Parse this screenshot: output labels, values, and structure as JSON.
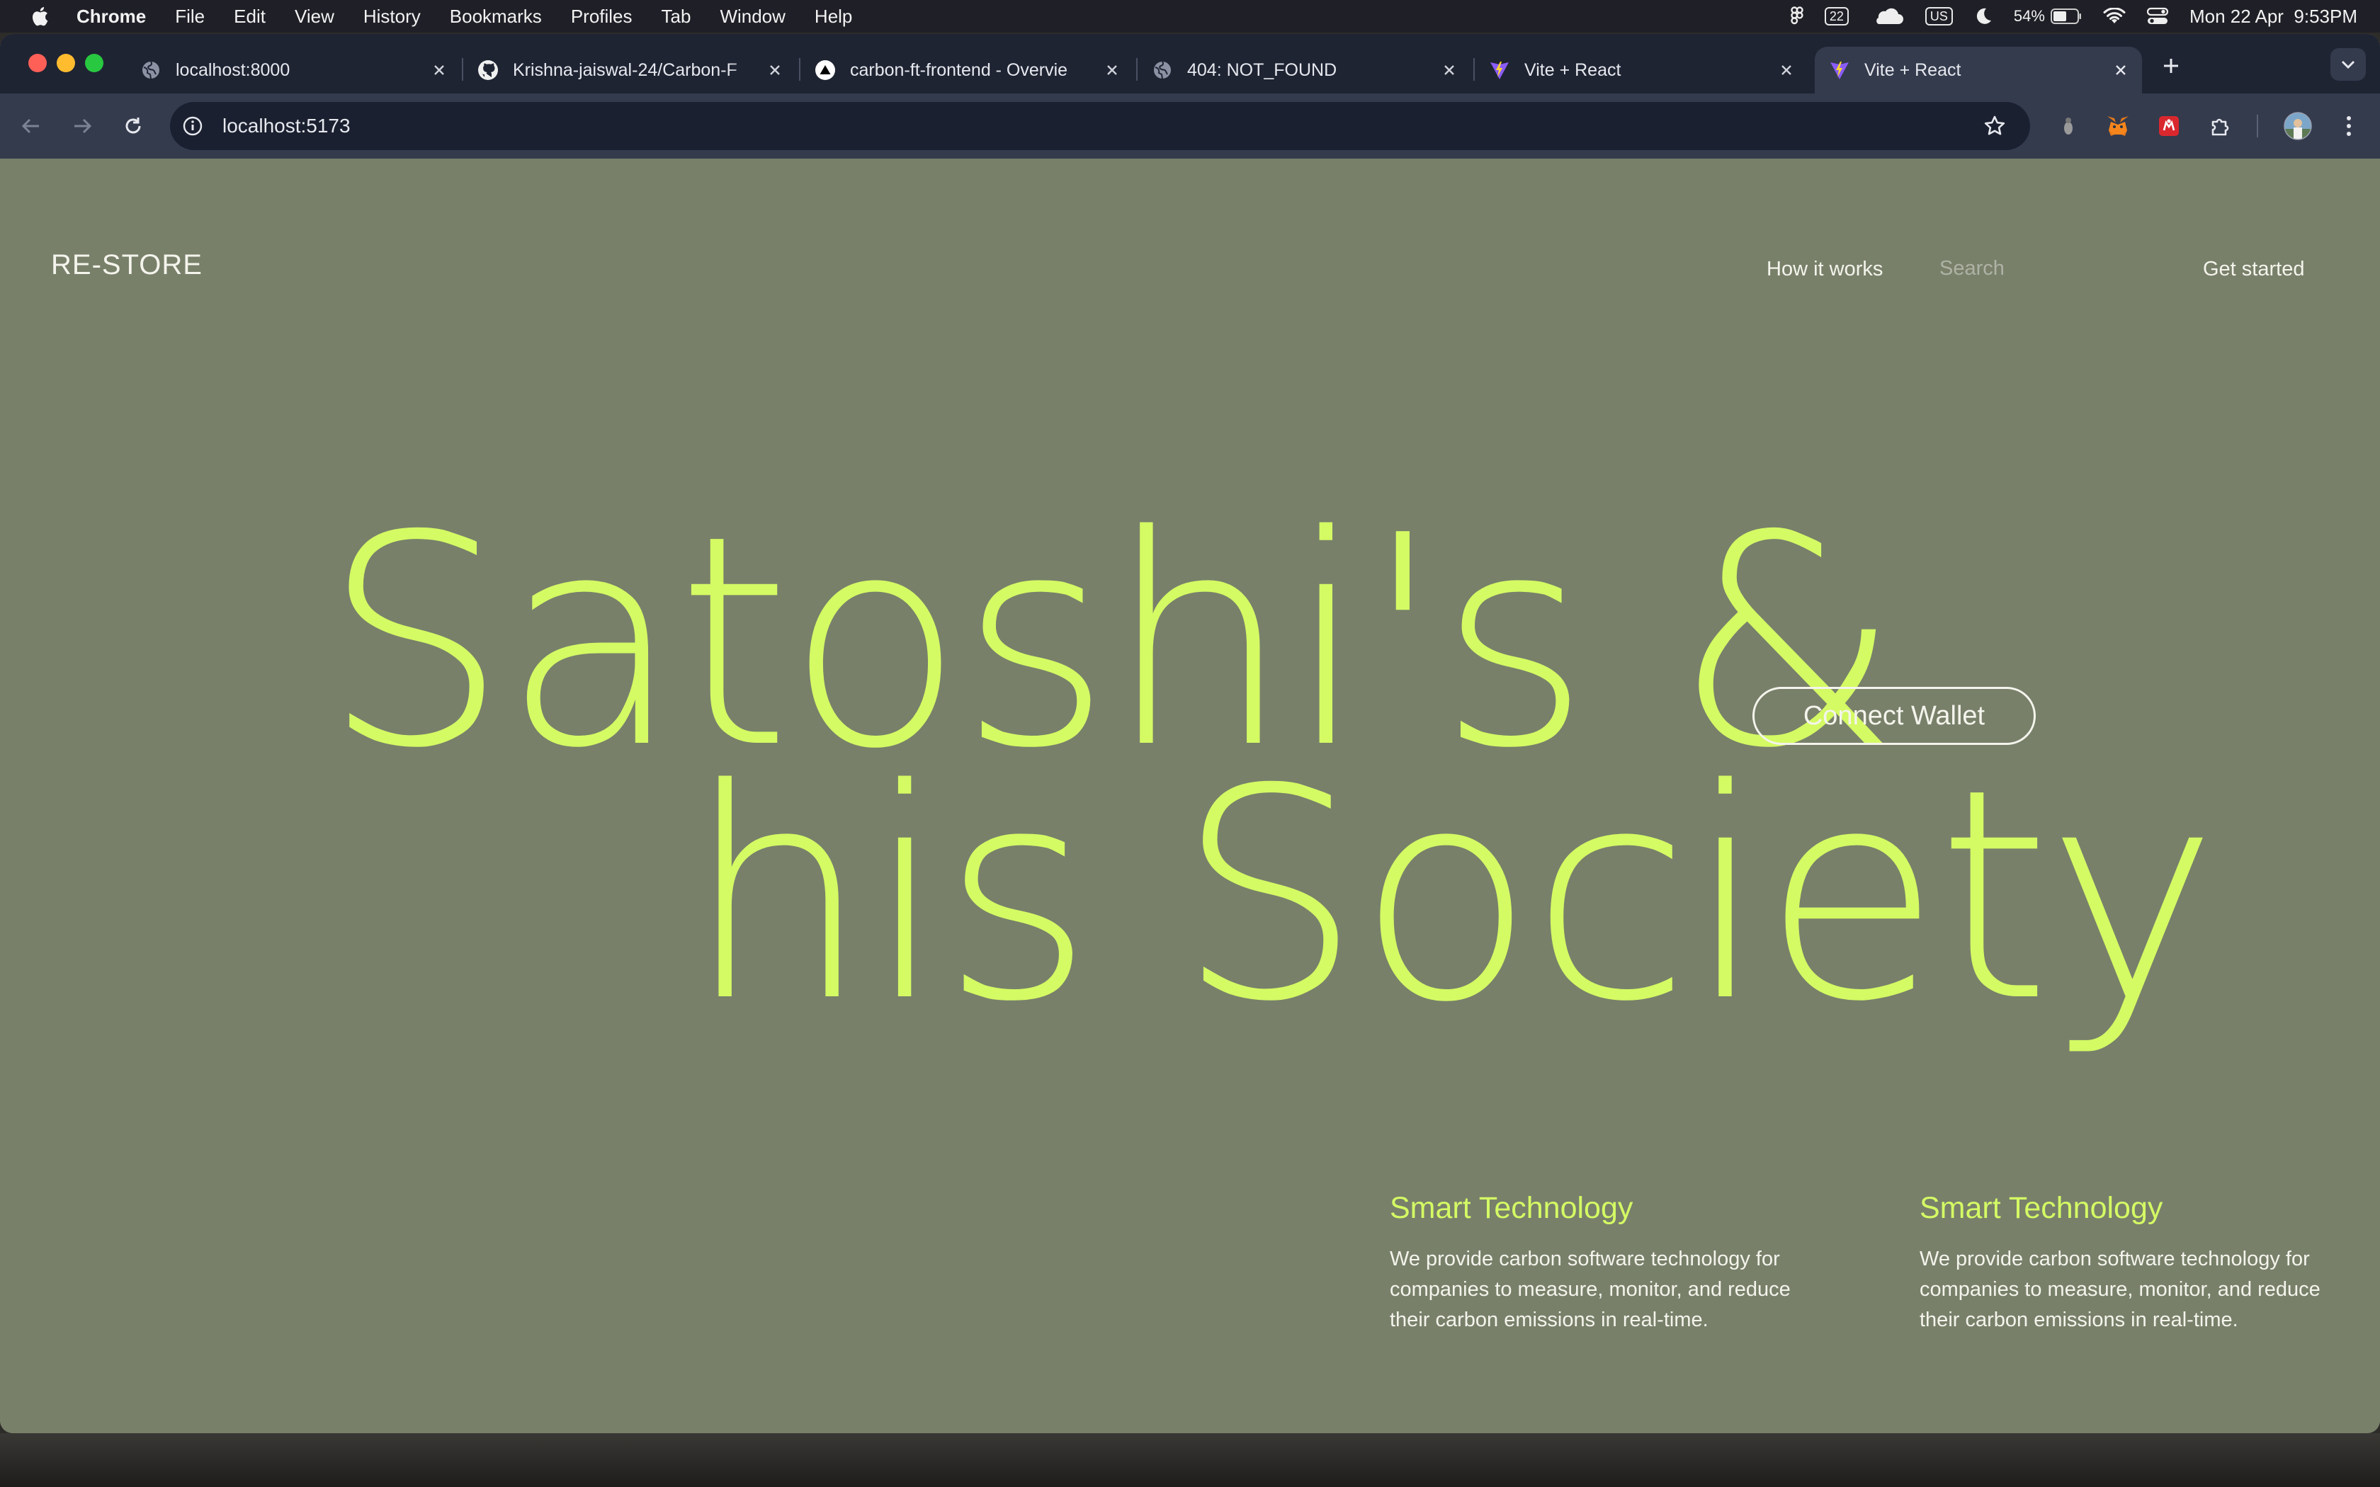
{
  "menubar": {
    "app_name": "Chrome",
    "menus": [
      "File",
      "Edit",
      "View",
      "History",
      "Bookmarks",
      "Profiles",
      "Tab",
      "Window",
      "Help"
    ],
    "calendar_badge": "22",
    "input_source": "US",
    "battery": "54%",
    "datetime": "Mon 22 Apr  9:53PM"
  },
  "tabs": [
    {
      "title": "localhost:8000",
      "icon": "globe-icon",
      "active": false
    },
    {
      "title": "Krishna-jaiswal-24/Carbon-F",
      "icon": "github-icon",
      "active": false
    },
    {
      "title": "carbon-ft-frontend - Overvie",
      "icon": "vercel-icon",
      "active": false
    },
    {
      "title": "404: NOT_FOUND",
      "icon": "globe-icon",
      "active": false
    },
    {
      "title": "Vite + React",
      "icon": "vite-icon",
      "active": false
    },
    {
      "title": "Vite + React",
      "icon": "vite-icon",
      "active": true
    }
  ],
  "toolbar": {
    "url": "localhost:5173"
  },
  "site": {
    "logo": "RE-STORE",
    "nav": {
      "how_it_works": "How it works",
      "search_placeholder": "Search",
      "get_started": "Get started"
    },
    "hero": {
      "line1": "Satoshi's &",
      "line2": "his Society",
      "cta": "Connect Wallet"
    },
    "features": [
      {
        "title": "Smart Technology",
        "text": "We provide carbon software technology for companies to measure, monitor, and reduce their carbon emissions in real-time."
      },
      {
        "title": "Smart Technology",
        "text": "We provide carbon software technology for companies to measure, monitor, and reduce their carbon emissions in real-time."
      }
    ]
  },
  "colors": {
    "page_background": "#78806a",
    "accent": "#d4fa64",
    "text_light": "#f4f4ec"
  }
}
